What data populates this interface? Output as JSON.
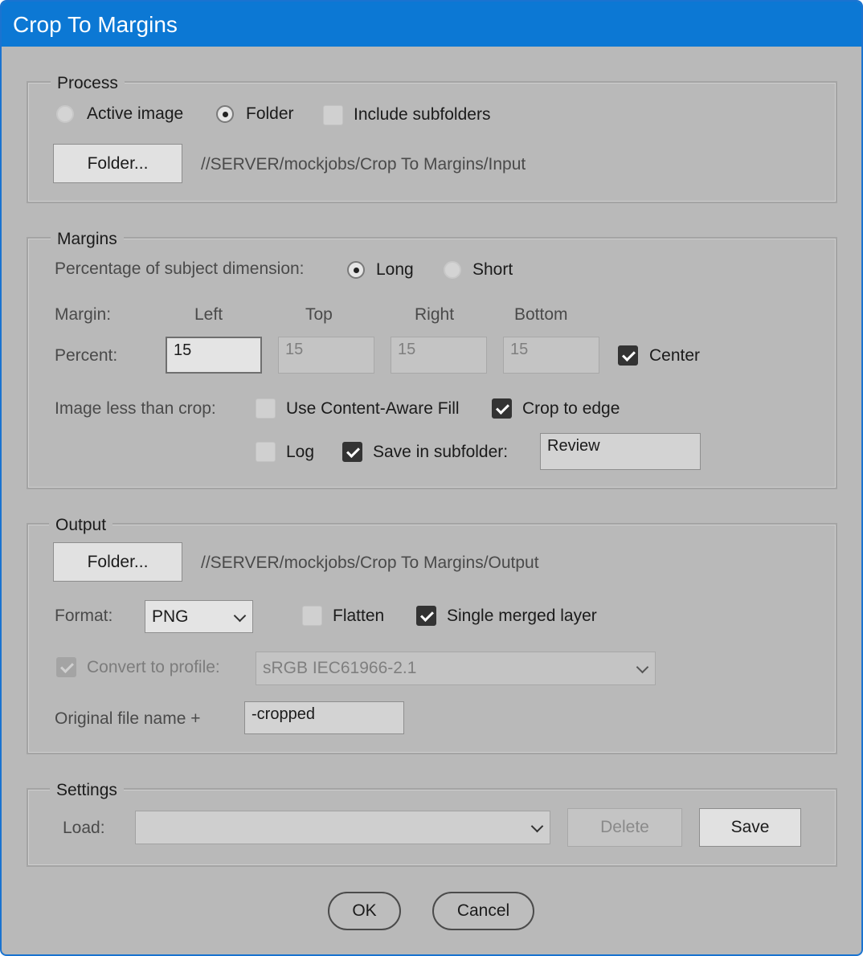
{
  "window": {
    "title": "Crop To Margins"
  },
  "process": {
    "legend": "Process",
    "active_image_label": "Active image",
    "folder_label": "Folder",
    "include_subfolders_label": "Include subfolders",
    "folder_button": "Folder...",
    "input_path": "//SERVER/mockjobs/Crop To Margins/Input"
  },
  "margins": {
    "legend": "Margins",
    "percentage_label": "Percentage of subject dimension:",
    "long_label": "Long",
    "short_label": "Short",
    "margin_label": "Margin:",
    "col_left": "Left",
    "col_top": "Top",
    "col_right": "Right",
    "col_bottom": "Bottom",
    "percent_label": "Percent:",
    "left_value": "15",
    "top_value": "15",
    "right_value": "15",
    "bottom_value": "15",
    "center_label": "Center",
    "image_less_label": "Image less than crop:",
    "content_aware_label": "Use Content-Aware Fill",
    "crop_edge_label": "Crop to edge",
    "log_label": "Log",
    "save_subfolder_label": "Save in subfolder:",
    "subfolder_value": "Review"
  },
  "output": {
    "legend": "Output",
    "folder_button": "Folder...",
    "output_path": "//SERVER/mockjobs/Crop To Margins/Output",
    "format_label": "Format:",
    "format_value": "PNG",
    "flatten_label": "Flatten",
    "single_layer_label": "Single merged layer",
    "convert_label": "Convert to profile:",
    "profile_value": "sRGB IEC61966-2.1",
    "filename_label": "Original file name +",
    "filename_suffix": "-cropped"
  },
  "settings": {
    "legend": "Settings",
    "load_label": "Load:",
    "load_value": "",
    "delete_button": "Delete",
    "save_button": "Save"
  },
  "footer": {
    "ok_button": "OK",
    "cancel_button": "Cancel"
  },
  "colors": {
    "titlebar": "#0c78d4",
    "dialog_bg": "#b9b9b9",
    "checkbox_checked": "#333333"
  }
}
